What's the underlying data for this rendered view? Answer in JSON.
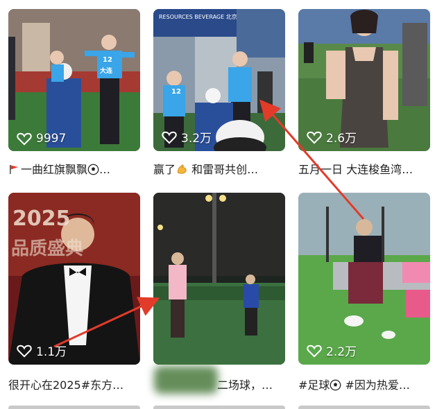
{
  "cards": [
    {
      "likes": "9997",
      "caption": "一曲红旗飘飘",
      "caption_suffix": "…",
      "lead_icon": "red-flag-icon",
      "trail_icon": "soccer-ball-icon"
    },
    {
      "likes": "3.2万",
      "caption": "赢了",
      "caption_rest": " 和雷哥共创…",
      "mid_icon": "flexed-biceps-icon"
    },
    {
      "likes": "2.6万",
      "caption": "五月一日 大连梭鱼湾…"
    },
    {
      "likes": "1.1万",
      "caption": "很开心在2025#东方…"
    },
    {
      "likes": "",
      "caption": "二场球，…"
    },
    {
      "likes": "2.2万",
      "caption": "#足球",
      "caption_rest": " #因为热爱…",
      "mid_icon": "soccer-ball-icon"
    }
  ],
  "scene_text": {
    "jersey_number_1": "12",
    "jersey_brand_1": "大连",
    "jersey_number_2": "12",
    "banner_text": "RESOURCES BEVERAGE 北京",
    "backdrop_text": "2025",
    "backdrop_text_2": "品质盛典"
  },
  "colors": {
    "accent_red": "#e23b2a",
    "jersey_blue": "#3aa5e8"
  }
}
